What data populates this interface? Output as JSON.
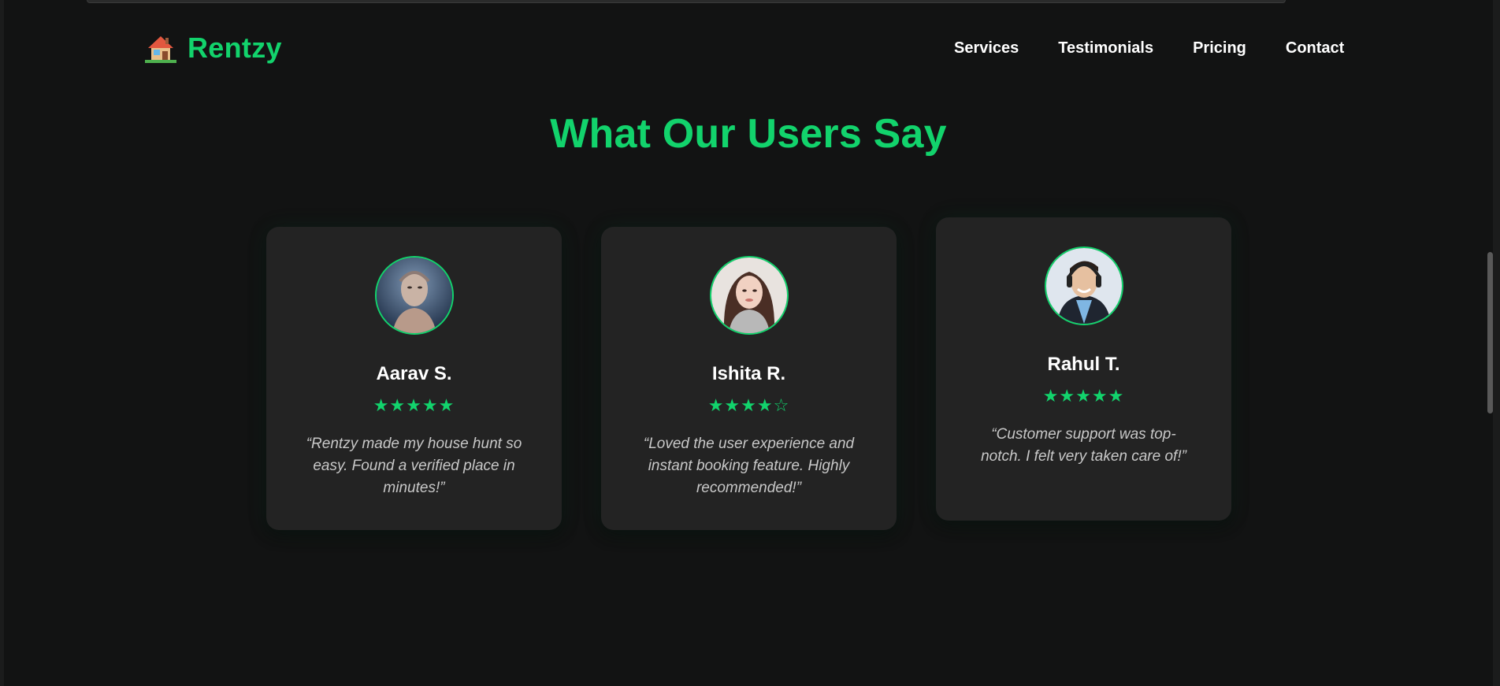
{
  "brand": {
    "name": "Rentzy",
    "icon": "house-emoji-icon",
    "color": "#12d36c"
  },
  "nav": {
    "links": [
      "Services",
      "Testimonials",
      "Pricing",
      "Contact"
    ]
  },
  "section": {
    "title": "What Our Users Say"
  },
  "testimonials": [
    {
      "name": "Aarav S.",
      "stars": "★★★★★",
      "rating": 5,
      "quote": "“Rentzy made my house hunt so easy. Found a verified place in minutes!”",
      "avatar": "man-portrait-avatar"
    },
    {
      "name": "Ishita R.",
      "stars": "★★★★☆",
      "rating": 4,
      "quote": "“Loved the user experience and instant booking feature. Highly recommended!”",
      "avatar": "woman-portrait-avatar"
    },
    {
      "name": "Rahul T.",
      "stars": "★★★★★",
      "rating": 5,
      "quote": "“Customer support was top-notch. I felt very taken care of!”",
      "avatar": "smiling-man-portrait-avatar"
    }
  ],
  "colors": {
    "accent": "#12d36c",
    "background": "#121313",
    "card": "#232323",
    "text": "#ffffff",
    "quote": "#c8c8c8"
  }
}
